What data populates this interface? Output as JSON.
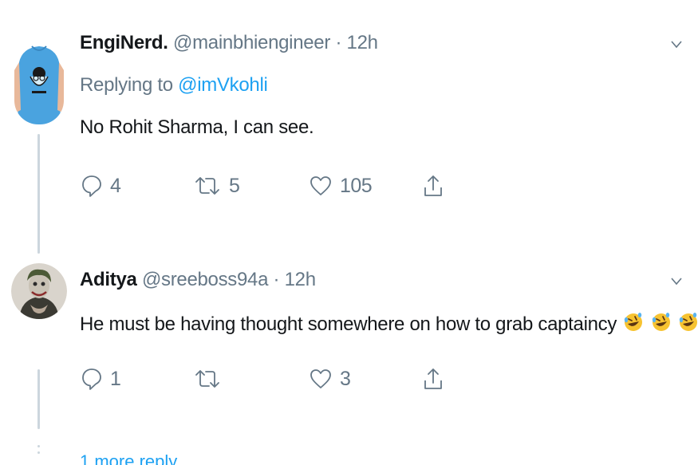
{
  "tweets": [
    {
      "name": "EngiNerd.",
      "handle": "@mainbhiengineer",
      "separator": "·",
      "time": "12h",
      "replying_prefix": "Replying to",
      "replying_to": "@imVkohli",
      "text": "No Rohit Sharma, I can see.",
      "reply_count": "4",
      "retweet_count": "5",
      "like_count": "105"
    },
    {
      "name": "Aditya",
      "handle": "@sreeboss94a",
      "separator": "·",
      "time": "12h",
      "text": "He must be having thought somewhere on how to grab captaincy",
      "emojis": [
        "rolling-on-floor-laughing-emoji",
        "rolling-on-floor-laughing-emoji",
        "rolling-on-floor-laughing-emoji"
      ],
      "reply_count": "1",
      "retweet_count": "",
      "like_count": "3"
    }
  ],
  "more_replies": "1 more reply",
  "colors": {
    "link": "#1da1f2",
    "muted": "#657786",
    "text": "#14171a",
    "thread_line": "#ccd6dd"
  }
}
